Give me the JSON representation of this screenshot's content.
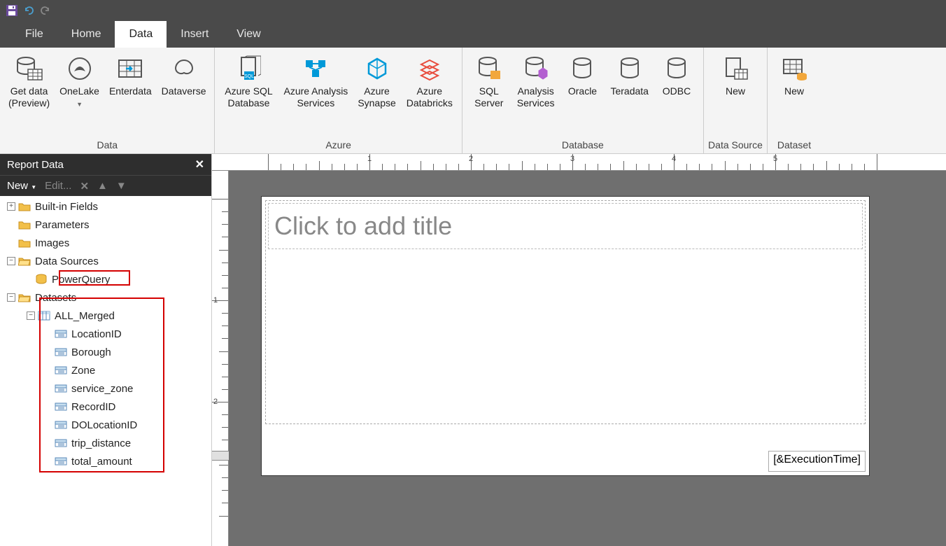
{
  "titlebar": {
    "save_title": "Save"
  },
  "tabs": {
    "file": "File",
    "home": "Home",
    "data": "Data",
    "insert": "Insert",
    "view": "View",
    "active": "Data"
  },
  "ribbon": {
    "groups": [
      {
        "label": "Data",
        "buttons": [
          {
            "name": "get-data",
            "label1": "Get data",
            "label2": "(Preview)"
          },
          {
            "name": "onelake",
            "label1": "OneLake",
            "hasDropdown": true
          },
          {
            "name": "enterdata",
            "label1": "Enterdata"
          },
          {
            "name": "dataverse",
            "label1": "Dataverse"
          }
        ]
      },
      {
        "label": "Azure",
        "buttons": [
          {
            "name": "azure-sql",
            "label1": "Azure SQL",
            "label2": "Database"
          },
          {
            "name": "azure-analysis",
            "label1": "Azure Analysis",
            "label2": "Services"
          },
          {
            "name": "azure-synapse",
            "label1": "Azure",
            "label2": "Synapse"
          },
          {
            "name": "azure-databricks",
            "label1": "Azure",
            "label2": "Databricks"
          }
        ]
      },
      {
        "label": "Database",
        "buttons": [
          {
            "name": "sql-server",
            "label1": "SQL",
            "label2": "Server"
          },
          {
            "name": "analysis-services",
            "label1": "Analysis",
            "label2": "Services"
          },
          {
            "name": "oracle",
            "label1": "Oracle"
          },
          {
            "name": "teradata",
            "label1": "Teradata"
          },
          {
            "name": "odbc",
            "label1": "ODBC"
          }
        ]
      },
      {
        "label": "Data Source",
        "buttons": [
          {
            "name": "new-datasource",
            "label1": "New"
          }
        ]
      },
      {
        "label": "Dataset",
        "buttons": [
          {
            "name": "new-dataset",
            "label1": "New"
          }
        ]
      }
    ]
  },
  "panel": {
    "title": "Report Data",
    "toolbar": {
      "new": "New",
      "edit": "Edit..."
    },
    "tree": {
      "builtin": "Built-in Fields",
      "parameters": "Parameters",
      "images": "Images",
      "datasources": "Data Sources",
      "powerquery": "PowerQuery",
      "datasets": "Datasets",
      "all_merged": "ALL_Merged",
      "fields": [
        "LocationID",
        "Borough",
        "Zone",
        "service_zone",
        "RecordID",
        "DOLocationID",
        "trip_distance",
        "total_amount"
      ]
    }
  },
  "canvas": {
    "title_placeholder": "Click to add title",
    "execution_time": "[&ExecutionTime]",
    "ruler_h": [
      "1",
      "2",
      "3",
      "4",
      "5"
    ],
    "ruler_v": [
      "1",
      "2"
    ]
  },
  "colors": {
    "azure": "#0099d8",
    "databricks": "#e84c3d",
    "yellow": "#f2a73b",
    "purple": "#b35fd0"
  }
}
